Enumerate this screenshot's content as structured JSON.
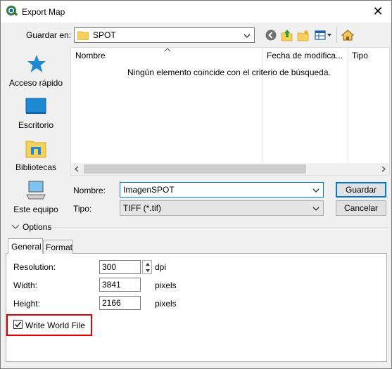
{
  "window": {
    "title": "Export Map"
  },
  "toolbar": {
    "look_in_label": "Guardar en:",
    "look_in_value": "SPOT"
  },
  "places": [
    {
      "label": "Acceso rápido",
      "icon": "star-icon"
    },
    {
      "label": "Escritorio",
      "icon": "desktop-icon"
    },
    {
      "label": "Bibliotecas",
      "icon": "libraries-icon"
    },
    {
      "label": "Este equipo",
      "icon": "computer-icon"
    }
  ],
  "file_list": {
    "columns": [
      "Nombre",
      "Fecha de modifica...",
      "Tipo"
    ],
    "empty_message": "Ningún elemento coincide con el criterio de búsqueda."
  },
  "file_name": {
    "label": "Nombre:",
    "value": "ImagenSPOT"
  },
  "file_type": {
    "label": "Tipo:",
    "value": "TIFF (*.tif)"
  },
  "buttons": {
    "save": "Guardar",
    "cancel": "Cancelar"
  },
  "options": {
    "label": "Options",
    "tabs": [
      "General",
      "Format"
    ],
    "resolution": {
      "label": "Resolution:",
      "value": "300",
      "unit": "dpi"
    },
    "width": {
      "label": "Width:",
      "value": "3841",
      "unit": "pixels"
    },
    "height": {
      "label": "Height:",
      "value": "2166",
      "unit": "pixels"
    },
    "write_world_file": {
      "label": "Write World File",
      "checked": true
    }
  },
  "colors": {
    "accent": "#0078d7",
    "highlight": "#e00000"
  }
}
